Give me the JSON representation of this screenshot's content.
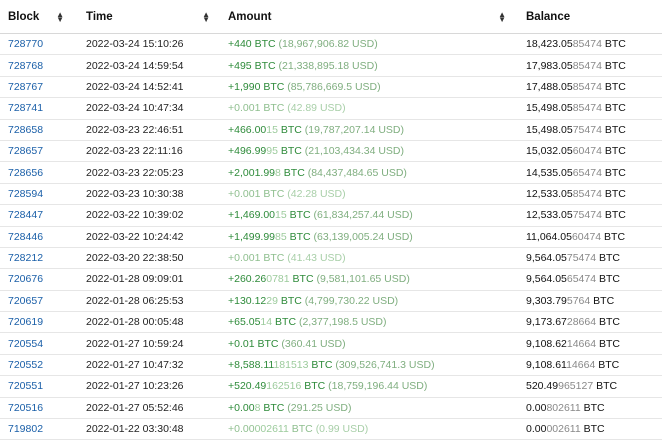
{
  "headers": {
    "block": "Block",
    "time": "Time",
    "amount": "Amount",
    "balance": "Balance"
  },
  "rows": [
    {
      "block": "728770",
      "time": "2022-03-24 15:10:26",
      "amount_main": "+440 BTC",
      "amount_faint": "",
      "amount_usd": "(18,967,906.82 USD)",
      "dim": false,
      "bal_main": "18,423.05",
      "bal_faint": "85474",
      "bal_unit": " BTC"
    },
    {
      "block": "728768",
      "time": "2022-03-24 14:59:54",
      "amount_main": "+495 BTC",
      "amount_faint": "",
      "amount_usd": "(21,338,895.18 USD)",
      "dim": false,
      "bal_main": "17,983.05",
      "bal_faint": "85474",
      "bal_unit": " BTC"
    },
    {
      "block": "728767",
      "time": "2022-03-24 14:52:41",
      "amount_main": "+1,990 BTC",
      "amount_faint": "",
      "amount_usd": "(85,786,669.5 USD)",
      "dim": false,
      "bal_main": "17,488.05",
      "bal_faint": "85474",
      "bal_unit": " BTC"
    },
    {
      "block": "728741",
      "time": "2022-03-24 10:47:34",
      "amount_main": "+0.001 BTC",
      "amount_faint": "",
      "amount_usd": "(42.89 USD)",
      "dim": true,
      "bal_main": "15,498.05",
      "bal_faint": "85474",
      "bal_unit": " BTC"
    },
    {
      "block": "728658",
      "time": "2022-03-23 22:46:51",
      "amount_main": "+466.00",
      "amount_faint": "15",
      "amount_unit": " BTC",
      "amount_usd": "(19,787,207.14 USD)",
      "dim": false,
      "bal_main": "15,498.05",
      "bal_faint": "75474",
      "bal_unit": " BTC"
    },
    {
      "block": "728657",
      "time": "2022-03-23 22:11:16",
      "amount_main": "+496.99",
      "amount_faint": "95",
      "amount_unit": " BTC",
      "amount_usd": "(21,103,434.34 USD)",
      "dim": false,
      "bal_main": "15,032.05",
      "bal_faint": "60474",
      "bal_unit": " BTC"
    },
    {
      "block": "728656",
      "time": "2022-03-23 22:05:23",
      "amount_main": "+2,001.99",
      "amount_faint": "8",
      "amount_unit": " BTC",
      "amount_usd": "(84,437,484.65 USD)",
      "dim": false,
      "bal_main": "14,535.05",
      "bal_faint": "65474",
      "bal_unit": " BTC"
    },
    {
      "block": "728594",
      "time": "2022-03-23 10:30:38",
      "amount_main": "+0.001 BTC",
      "amount_faint": "",
      "amount_usd": "(42.28 USD)",
      "dim": true,
      "bal_main": "12,533.05",
      "bal_faint": "85474",
      "bal_unit": " BTC"
    },
    {
      "block": "728447",
      "time": "2022-03-22 10:39:02",
      "amount_main": "+1,469.00",
      "amount_faint": "15",
      "amount_unit": " BTC",
      "amount_usd": "(61,834,257.44 USD)",
      "dim": false,
      "bal_main": "12,533.05",
      "bal_faint": "75474",
      "bal_unit": " BTC"
    },
    {
      "block": "728446",
      "time": "2022-03-22 10:24:42",
      "amount_main": "+1,499.99",
      "amount_faint": "85",
      "amount_unit": " BTC",
      "amount_usd": "(63,139,005.24 USD)",
      "dim": false,
      "bal_main": "11,064.05",
      "bal_faint": "60474",
      "bal_unit": " BTC"
    },
    {
      "block": "728212",
      "time": "2022-03-20 22:38:50",
      "amount_main": "+0.001 BTC",
      "amount_faint": "",
      "amount_usd": "(41.43 USD)",
      "dim": true,
      "bal_main": "9,564.05",
      "bal_faint": "75474",
      "bal_unit": " BTC"
    },
    {
      "block": "720676",
      "time": "2022-01-28 09:09:01",
      "amount_main": "+260.26",
      "amount_faint": "0781",
      "amount_unit": " BTC",
      "amount_usd": "(9,581,101.65 USD)",
      "dim": false,
      "bal_main": "9,564.05",
      "bal_faint": "65474",
      "bal_unit": " BTC"
    },
    {
      "block": "720657",
      "time": "2022-01-28 06:25:53",
      "amount_main": "+130.12",
      "amount_faint": "29",
      "amount_unit": " BTC",
      "amount_usd": "(4,799,730.22 USD)",
      "dim": false,
      "bal_main": "9,303.79",
      "bal_faint": "5764",
      "bal_unit": " BTC"
    },
    {
      "block": "720619",
      "time": "2022-01-28 00:05:48",
      "amount_main": "+65.05",
      "amount_faint": "14",
      "amount_unit": " BTC",
      "amount_usd": "(2,377,198.5 USD)",
      "dim": false,
      "bal_main": "9,173.67",
      "bal_faint": "28664",
      "bal_unit": " BTC"
    },
    {
      "block": "720554",
      "time": "2022-01-27 10:59:24",
      "amount_main": "+0.01 BTC",
      "amount_faint": "",
      "amount_usd": "(360.41 USD)",
      "dim": false,
      "bal_main": "9,108.62",
      "bal_faint": "14664",
      "bal_unit": " BTC"
    },
    {
      "block": "720552",
      "time": "2022-01-27 10:47:32",
      "amount_main": "+8,588.11",
      "amount_faint": "181513",
      "amount_unit": " BTC",
      "amount_usd": "(309,526,741.3 USD)",
      "dim": false,
      "bal_main": "9,108.61",
      "bal_faint": "14664",
      "bal_unit": " BTC"
    },
    {
      "block": "720551",
      "time": "2022-01-27 10:23:26",
      "amount_main": "+520.49",
      "amount_faint": "162516",
      "amount_unit": " BTC",
      "amount_usd": "(18,759,196.44 USD)",
      "dim": false,
      "bal_main": "520.49",
      "bal_faint": "965127",
      "bal_unit": " BTC"
    },
    {
      "block": "720516",
      "time": "2022-01-27 05:52:46",
      "amount_main": "+0.00",
      "amount_faint": "8",
      "amount_unit": " BTC",
      "amount_usd": "(291.25 USD)",
      "dim": false,
      "bal_main": "0.00",
      "bal_faint": "802611",
      "bal_unit": " BTC"
    },
    {
      "block": "719802",
      "time": "2022-01-22 03:30:48",
      "amount_main": "+0.00",
      "amount_faint": "002611",
      "amount_unit": " BTC",
      "amount_usd": "(0.99 USD)",
      "dim": true,
      "bal_main": "0.00",
      "bal_faint": "002611",
      "bal_unit": " BTC"
    }
  ]
}
